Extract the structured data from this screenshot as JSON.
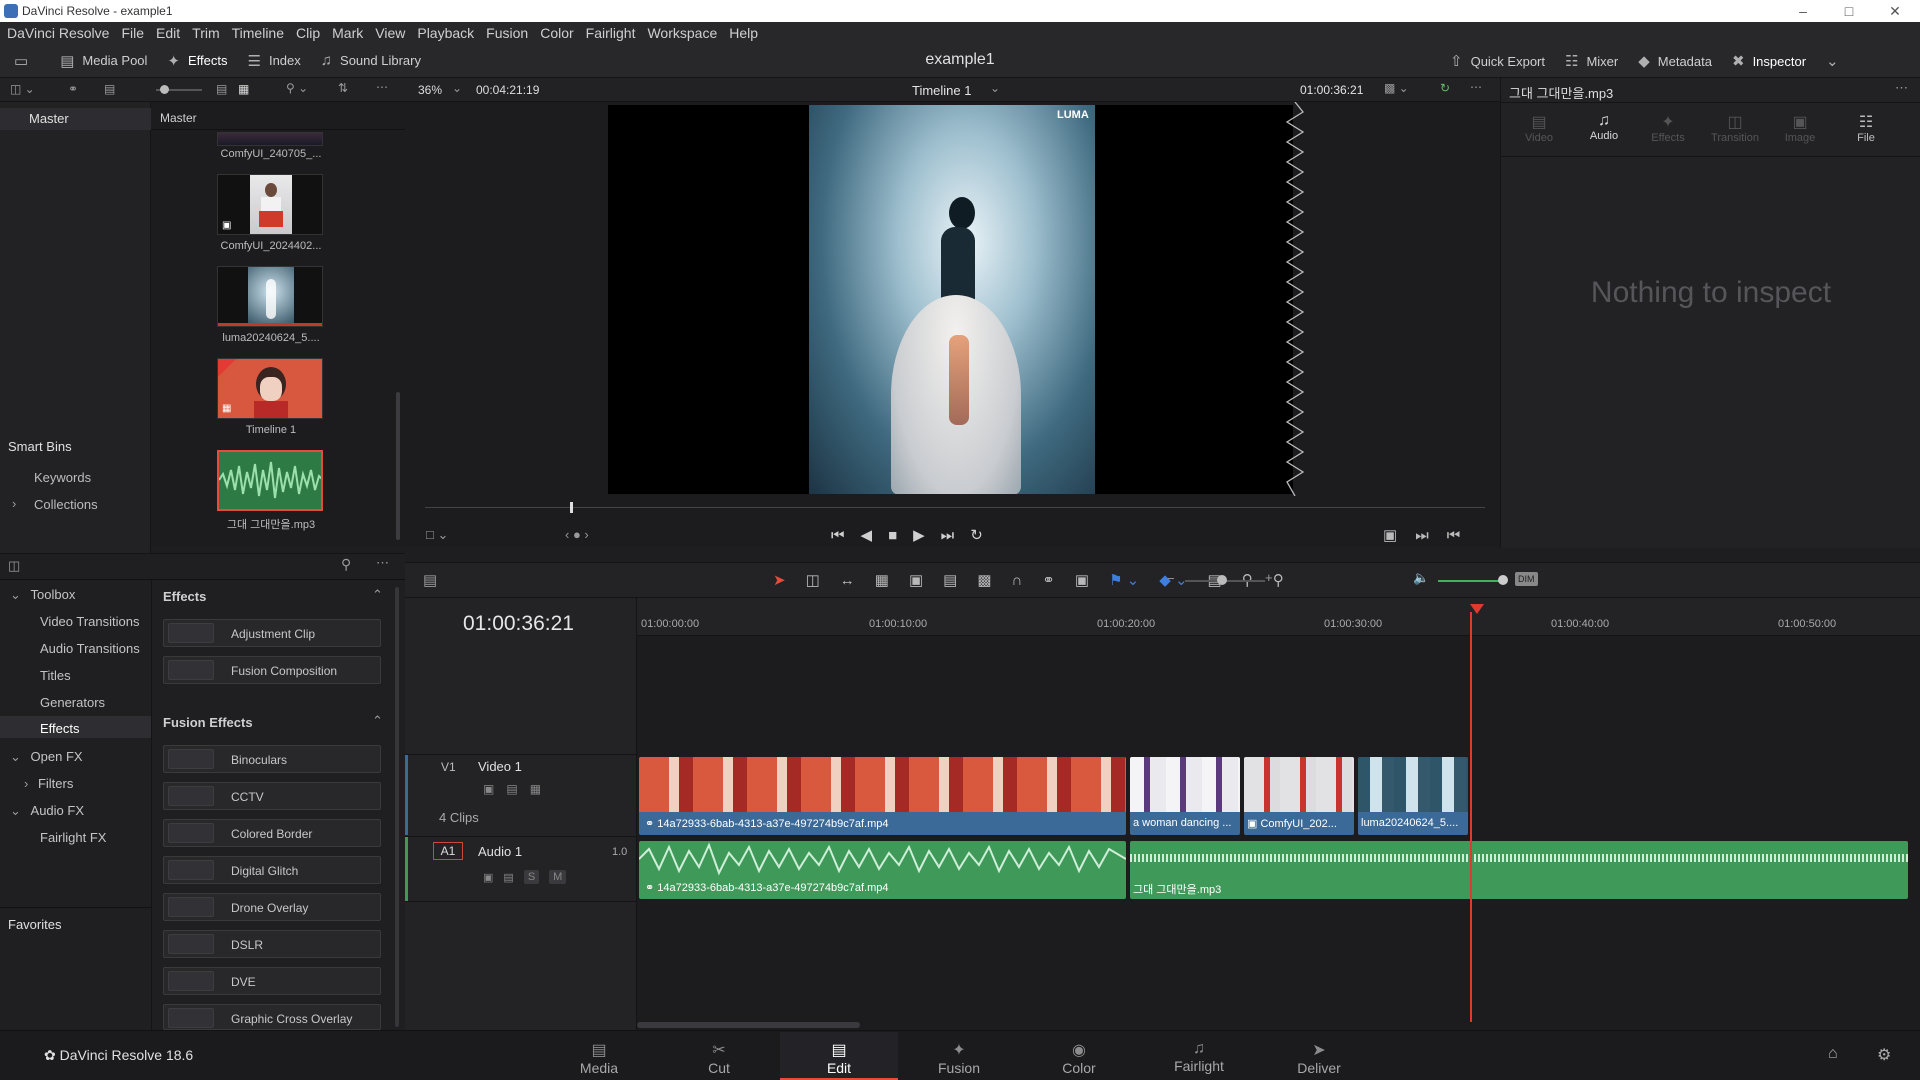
{
  "window": {
    "title": "DaVinci Resolve - example1",
    "project": "example1"
  },
  "menu": [
    "DaVinci Resolve",
    "File",
    "Edit",
    "Trim",
    "Timeline",
    "Clip",
    "Mark",
    "View",
    "Playback",
    "Fusion",
    "Color",
    "Fairlight",
    "Workspace",
    "Help"
  ],
  "toolbar": {
    "media_pool": "Media Pool",
    "effects": "Effects",
    "index": "Index",
    "sound_library": "Sound Library",
    "quick_export": "Quick Export",
    "mixer": "Mixer",
    "metadata": "Metadata",
    "inspector": "Inspector"
  },
  "viewer": {
    "zoom": "36%",
    "duration": "00:04:21:19",
    "timeline_name": "Timeline 1",
    "timecode": "01:00:36:21",
    "watermark": "LUMA"
  },
  "inspector": {
    "file": "그대 그대만을.mp3",
    "tabs": [
      "Video",
      "Audio",
      "Effects",
      "Transition",
      "Image",
      "File"
    ],
    "empty": "Nothing to inspect"
  },
  "bins": {
    "master": "Master",
    "pool_header": "Master",
    "smart_bins": "Smart Bins",
    "keywords": "Keywords",
    "collections": "Collections"
  },
  "pool_items": [
    "ComfyUI_240705_...",
    "ComfyUI_2024402...",
    "luma20240624_5....",
    "Timeline 1",
    "그대 그대만을.mp3"
  ],
  "toolbox": {
    "toolbox": "Toolbox",
    "video_transitions": "Video Transitions",
    "audio_transitions": "Audio Transitions",
    "titles": "Titles",
    "generators": "Generators",
    "effects": "Effects",
    "open_fx": "Open FX",
    "filters": "Filters",
    "audio_fx": "Audio FX",
    "fairlight_fx": "Fairlight FX",
    "favorites": "Favorites"
  },
  "effects_panel": {
    "effects_title": "Effects",
    "items": [
      "Adjustment Clip",
      "Fusion Composition"
    ],
    "fusion_title": "Fusion Effects",
    "fusion_items": [
      "Binoculars",
      "CCTV",
      "Colored Border",
      "Digital Glitch",
      "Drone Overlay",
      "DSLR",
      "DVE",
      "Graphic Cross Overlay"
    ]
  },
  "timeline": {
    "timecode": "01:00:36:21",
    "ruler": [
      "01:00:00:00",
      "01:00:10:00",
      "01:00:20:00",
      "01:00:30:00",
      "01:00:40:00",
      "01:00:50:00"
    ],
    "v1": {
      "id": "V1",
      "name": "Video 1",
      "clips_count": "4 Clips"
    },
    "a1": {
      "id": "A1",
      "name": "Audio 1",
      "level": "1.0",
      "s": "S",
      "m": "M"
    },
    "video_clips": [
      "14a72933-6bab-4313-a37e-497274b9c7af.mp4",
      "a woman dancing ...",
      "ComfyUI_202...",
      "luma20240624_5...."
    ],
    "audio_clips": [
      "14a72933-6bab-4313-a37e-497274b9c7af.mp4",
      "그대 그대만을.mp3"
    ]
  },
  "app_version": "DaVinci Resolve 18.6",
  "pages": [
    "Media",
    "Cut",
    "Edit",
    "Fusion",
    "Color",
    "Fairlight",
    "Deliver"
  ],
  "active_page": "Edit",
  "colors": {
    "accent": "#e64b3c",
    "video_clip": "#3b6a99",
    "audio_clip": "#3f9a5a",
    "playhead": "#e0392d"
  }
}
